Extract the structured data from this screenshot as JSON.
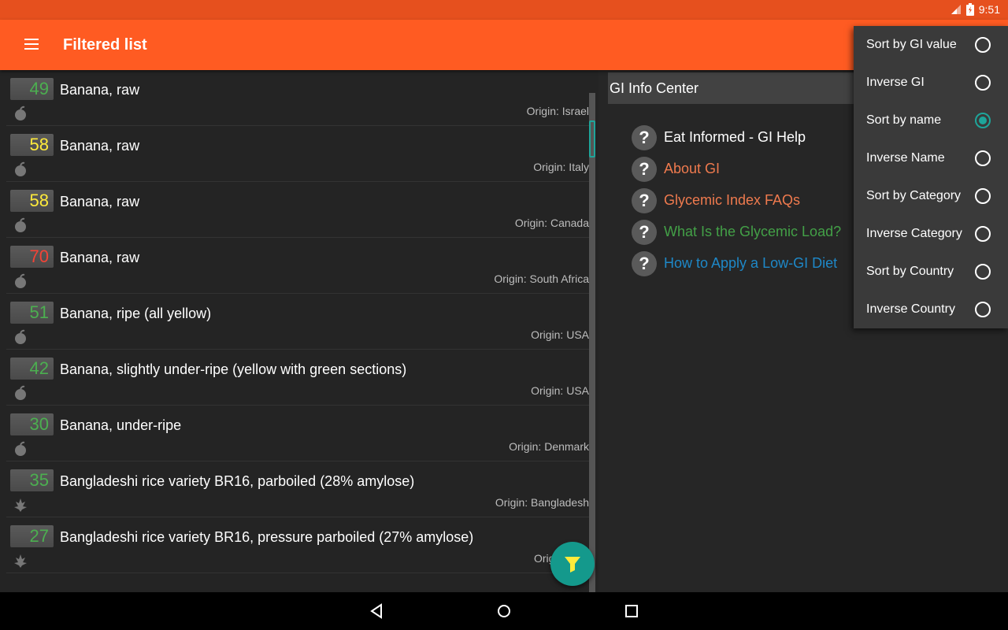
{
  "status_bar": {
    "time": "9:51"
  },
  "app_bar": {
    "title": "Filtered list"
  },
  "colors": {
    "gi_low": "#4caf50",
    "gi_medium": "#ffeb3b",
    "gi_high": "#f44336",
    "accent": "#14998c",
    "app_bar": "#ff5b22"
  },
  "food_list": [
    {
      "gi": "49",
      "name": "Banana, raw",
      "origin": "Origin: Israel",
      "gi_level": "low",
      "category_icon": "apple-icon"
    },
    {
      "gi": "58",
      "name": "Banana, raw",
      "origin": "Origin: Italy",
      "gi_level": "medium",
      "category_icon": "apple-icon"
    },
    {
      "gi": "58",
      "name": "Banana, raw",
      "origin": "Origin: Canada",
      "gi_level": "medium",
      "category_icon": "apple-icon"
    },
    {
      "gi": "70",
      "name": "Banana, raw",
      "origin": "Origin: South Africa",
      "gi_level": "high",
      "category_icon": "apple-icon"
    },
    {
      "gi": "51",
      "name": "Banana, ripe (all yellow)",
      "origin": "Origin: USA",
      "gi_level": "low",
      "category_icon": "apple-icon"
    },
    {
      "gi": "42",
      "name": "Banana, slightly under-ripe (yellow with green sections)",
      "origin": "Origin: USA",
      "gi_level": "low",
      "category_icon": "apple-icon"
    },
    {
      "gi": "30",
      "name": "Banana, under-ripe",
      "origin": "Origin: Denmark",
      "gi_level": "low",
      "category_icon": "apple-icon"
    },
    {
      "gi": "35",
      "name": "Bangladeshi rice variety BR16, parboiled (28% amylose)",
      "origin": "Origin: Bangladesh",
      "gi_level": "low",
      "category_icon": "grain-icon"
    },
    {
      "gi": "27",
      "name": "Bangladeshi rice variety BR16, pressure parboiled (27% amylose)",
      "origin": "Origin: Ban",
      "gi_level": "low",
      "category_icon": "grain-icon"
    }
  ],
  "info_center": {
    "header": "GI Info Center",
    "items": [
      {
        "label": "Eat Informed - GI Help",
        "color": "#ffffff"
      },
      {
        "label": "About GI",
        "color": "#ef7a4e"
      },
      {
        "label": "Glycemic Index FAQs",
        "color": "#ef7a4e"
      },
      {
        "label": "What Is the Glycemic Load?",
        "color": "#43a047"
      },
      {
        "label": "How to Apply a Low-GI Diet",
        "color": "#1e88c8"
      }
    ],
    "icon": "?"
  },
  "sort_menu": {
    "options": [
      {
        "label": "Sort by GI value",
        "selected": false
      },
      {
        "label": "Inverse GI",
        "selected": false
      },
      {
        "label": "Sort by name",
        "selected": true
      },
      {
        "label": "Inverse Name",
        "selected": false
      },
      {
        "label": "Sort by Category",
        "selected": false
      },
      {
        "label": "Inverse Category",
        "selected": false
      },
      {
        "label": "Sort by Country",
        "selected": false
      },
      {
        "label": "Inverse Country",
        "selected": false
      }
    ]
  }
}
